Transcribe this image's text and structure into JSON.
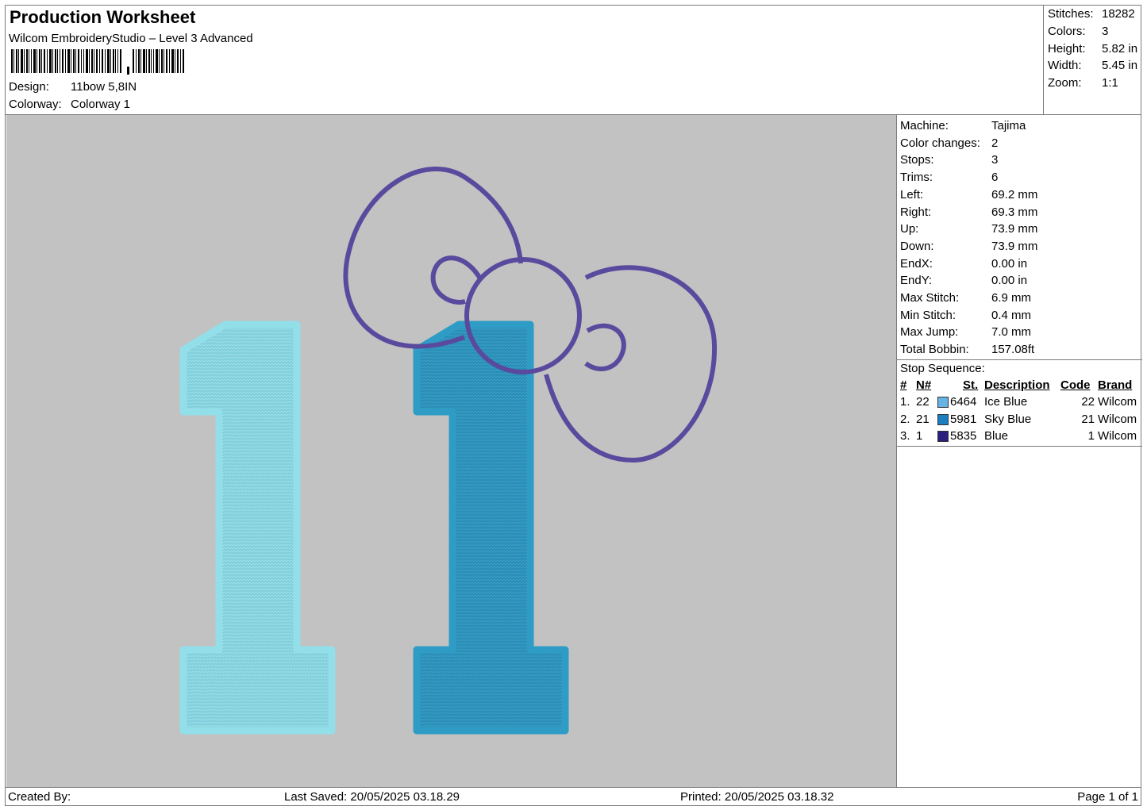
{
  "header": {
    "title": "Production Worksheet",
    "software": "Wilcom EmbroideryStudio – Level 3 Advanced",
    "design_label": "Design:",
    "design_value": "11bow 5,8IN",
    "colorway_label": "Colorway:",
    "colorway_value": "Colorway 1"
  },
  "summary": [
    {
      "label": "Stitches:",
      "value": "18282"
    },
    {
      "label": "Colors:",
      "value": "3"
    },
    {
      "label": "Height:",
      "value": "5.82 in"
    },
    {
      "label": "Width:",
      "value": "5.45 in"
    },
    {
      "label": "Zoom:",
      "value": "1:1"
    }
  ],
  "machine_info": [
    {
      "label": "Machine:",
      "value": "Tajima"
    },
    {
      "label": "Color changes:",
      "value": "2"
    },
    {
      "label": "Stops:",
      "value": "3"
    },
    {
      "label": "Trims:",
      "value": "6"
    },
    {
      "label": "Left:",
      "value": "69.2 mm"
    },
    {
      "label": "Right:",
      "value": "69.3 mm"
    },
    {
      "label": "Up:",
      "value": "73.9 mm"
    },
    {
      "label": "Down:",
      "value": "73.9 mm"
    },
    {
      "label": "EndX:",
      "value": "0.00 in"
    },
    {
      "label": "EndY:",
      "value": "0.00 in"
    },
    {
      "label": "Max Stitch:",
      "value": "6.9 mm"
    },
    {
      "label": "Min Stitch:",
      "value": "0.4 mm"
    },
    {
      "label": "Max Jump:",
      "value": "7.0 mm"
    },
    {
      "label": "Total Bobbin:",
      "value": "157.08ft"
    }
  ],
  "stop_sequence": {
    "title": "Stop Sequence:",
    "headers": {
      "index": "#",
      "number": "N#",
      "stitch": "St.",
      "description": "Description",
      "code": "Code",
      "brand": "Brand"
    },
    "rows": [
      {
        "index": "1.",
        "number": "22",
        "color": "#67b3e6",
        "stitch": "6464",
        "description": "Ice Blue",
        "code": "22",
        "brand": "Wilcom"
      },
      {
        "index": "2.",
        "number": "21",
        "color": "#1a7fc2",
        "stitch": "5981",
        "description": "Sky Blue",
        "code": "21",
        "brand": "Wilcom"
      },
      {
        "index": "3.",
        "number": "1",
        "color": "#2b1f7e",
        "stitch": "5835",
        "description": "Blue",
        "code": "1",
        "brand": "Wilcom"
      }
    ]
  },
  "design_colors": {
    "canvas": "#c2c2c2",
    "ice_blue": "#8fd8e4",
    "sky_blue": "#2d93bb",
    "bow": "#5a4a9e"
  },
  "footer": {
    "created_by": "Created By:",
    "last_saved": "Last Saved: 20/05/2025 03.18.29",
    "printed": "Printed: 20/05/2025 03.18.32",
    "page": "Page 1 of 1"
  }
}
